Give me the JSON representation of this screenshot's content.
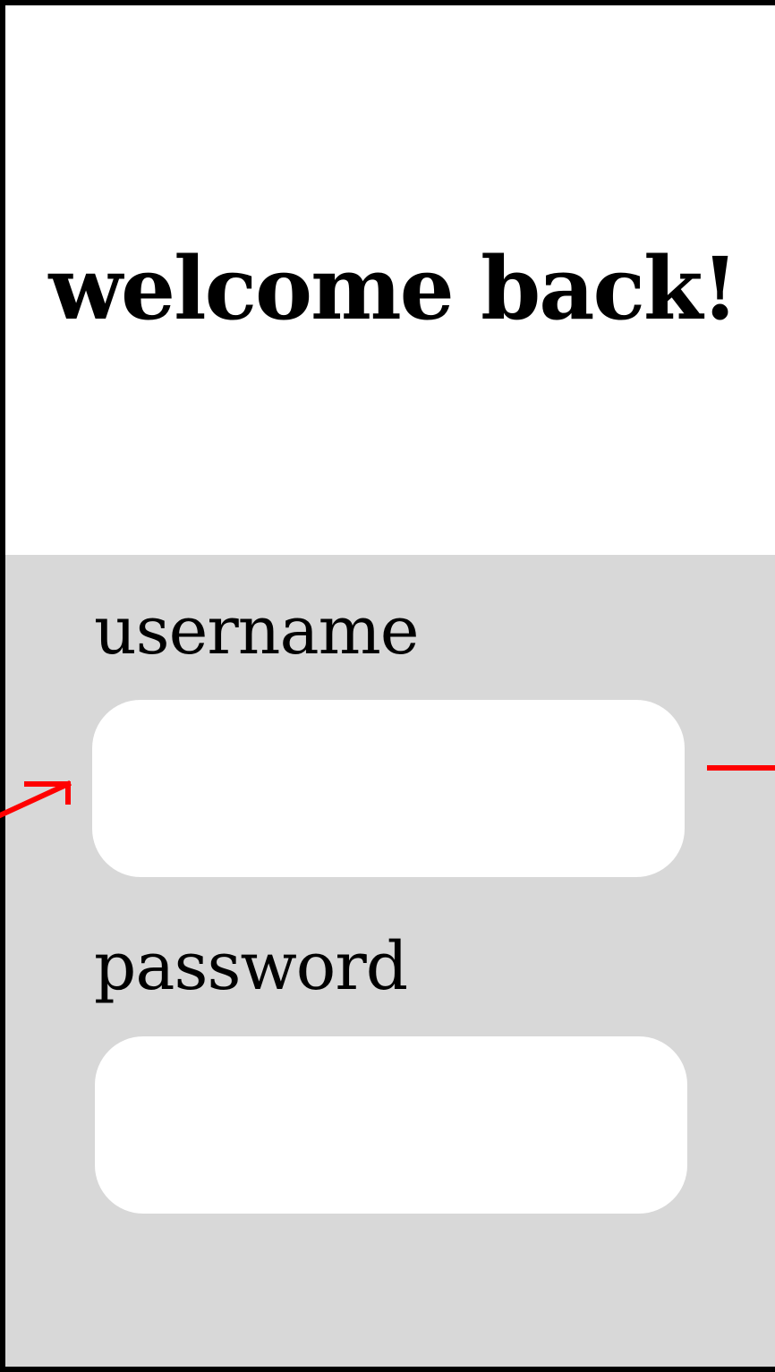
{
  "screen": {
    "title": "welcome back!"
  },
  "form": {
    "username": {
      "label": "username",
      "value": "",
      "placeholder": ""
    },
    "password": {
      "label": "password",
      "value": "",
      "placeholder": ""
    }
  },
  "annotations": {
    "color": "#ff0000",
    "marks": [
      "arrow-icon",
      "line-marker"
    ]
  },
  "colors": {
    "panel_background": "#d8d8d8",
    "input_background": "#ffffff",
    "border": "#000000"
  }
}
